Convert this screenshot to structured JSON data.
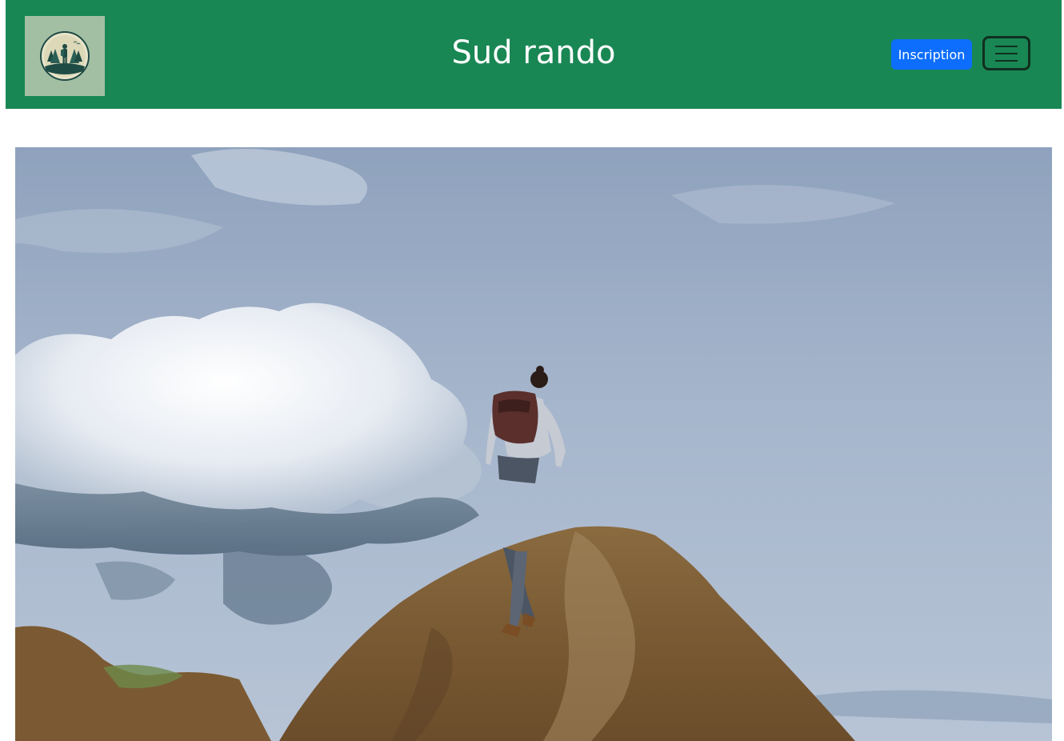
{
  "header": {
    "brand_title": "Sud rando",
    "signup_label": "Inscription",
    "logo_icon": "hiker-logo-icon",
    "menu_icon": "hamburger-menu-icon"
  },
  "hero": {
    "image": "hiker-on-rock-summit"
  },
  "colors": {
    "navbar_bg": "#198754",
    "button_primary": "#0d6efd",
    "logo_bg": "#a3bfa3"
  }
}
